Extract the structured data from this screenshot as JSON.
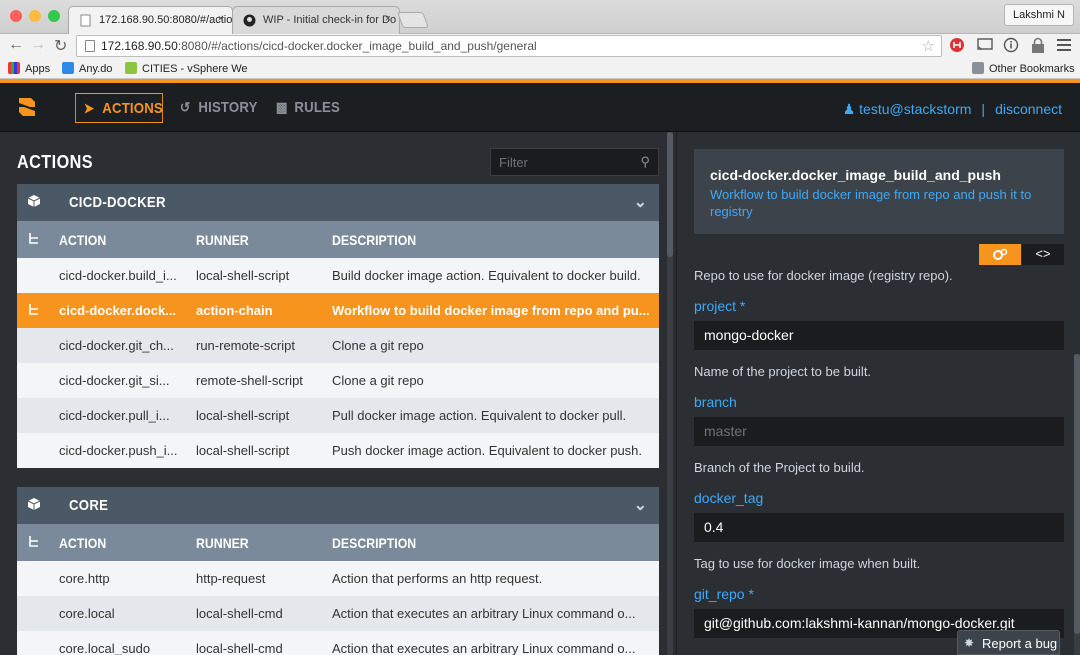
{
  "browser": {
    "tabs": [
      {
        "title": "172.168.90.50:8080/#/actio",
        "close": "×"
      },
      {
        "title": "WIP - Initial check-in for Do",
        "close": "×"
      }
    ],
    "user_chip": "Lakshmi N",
    "url_host": "172.168.90.50",
    "url_path": ":8080/#/actions/cicd-docker.docker_image_build_and_push/general",
    "bookmarks": [
      "Apps",
      "Any.do",
      "CITIES - vSphere We"
    ],
    "other_bookmarks": "Other Bookmarks"
  },
  "app": {
    "nav": [
      {
        "label": "ACTIONS",
        "icon": "rocket-icon"
      },
      {
        "label": "HISTORY",
        "icon": "history-icon"
      },
      {
        "label": "RULES",
        "icon": "book-icon"
      }
    ],
    "user": "testu@stackstorm",
    "separator": "|",
    "disconnect": "disconnect"
  },
  "left": {
    "title": "ACTIONS",
    "filter_placeholder": "Filter",
    "columns": {
      "action": "ACTION",
      "runner": "RUNNER",
      "description": "DESCRIPTION"
    },
    "groups": [
      {
        "name": "CICD-DOCKER",
        "rows": [
          {
            "action": "cicd-docker.build_i...",
            "runner": "local-shell-script",
            "description": "Build docker image action. Equivalent to docker build."
          },
          {
            "action": "cicd-docker.dock...",
            "runner": "action-chain",
            "description": "Workflow to build docker image from repo and pu..."
          },
          {
            "action": "cicd-docker.git_ch...",
            "runner": "run-remote-script",
            "description": "Clone a git repo"
          },
          {
            "action": "cicd-docker.git_si...",
            "runner": "remote-shell-script",
            "description": "Clone a git repo"
          },
          {
            "action": "cicd-docker.pull_i...",
            "runner": "local-shell-script",
            "description": "Pull docker image action. Equivalent to docker pull."
          },
          {
            "action": "cicd-docker.push_i...",
            "runner": "local-shell-script",
            "description": "Push docker image action. Equivalent to docker push."
          }
        ]
      },
      {
        "name": "CORE",
        "rows": [
          {
            "action": "core.http",
            "runner": "http-request",
            "description": "Action that performs an http request."
          },
          {
            "action": "core.local",
            "runner": "local-shell-cmd",
            "description": "Action that executes an arbitrary Linux command o..."
          },
          {
            "action": "core.local_sudo",
            "runner": "local-shell-cmd",
            "description": "Action that executes an arbitrary Linux command o..."
          }
        ]
      }
    ]
  },
  "right": {
    "name": "cicd-docker.docker_image_build_and_push",
    "description": "Workflow to build docker image from repo and push it to registry",
    "code_toggle": "<>",
    "repo_help": "Repo to use for docker image (registry repo).",
    "fields": [
      {
        "label": "project *",
        "value": "mongo-docker",
        "placeholder": "",
        "help": "Name of the project to be built."
      },
      {
        "label": "branch",
        "value": "",
        "placeholder": "master",
        "help": "Branch of the Project to build."
      },
      {
        "label": "docker_tag",
        "value": "0.4",
        "placeholder": "",
        "help": "Tag to use for docker image when built."
      },
      {
        "label": "git_repo *",
        "value": "git@github.com:lakshmi-kannan/mongo-docker.git",
        "placeholder": "",
        "help": ""
      }
    ],
    "report_bug": "Report a bug"
  }
}
